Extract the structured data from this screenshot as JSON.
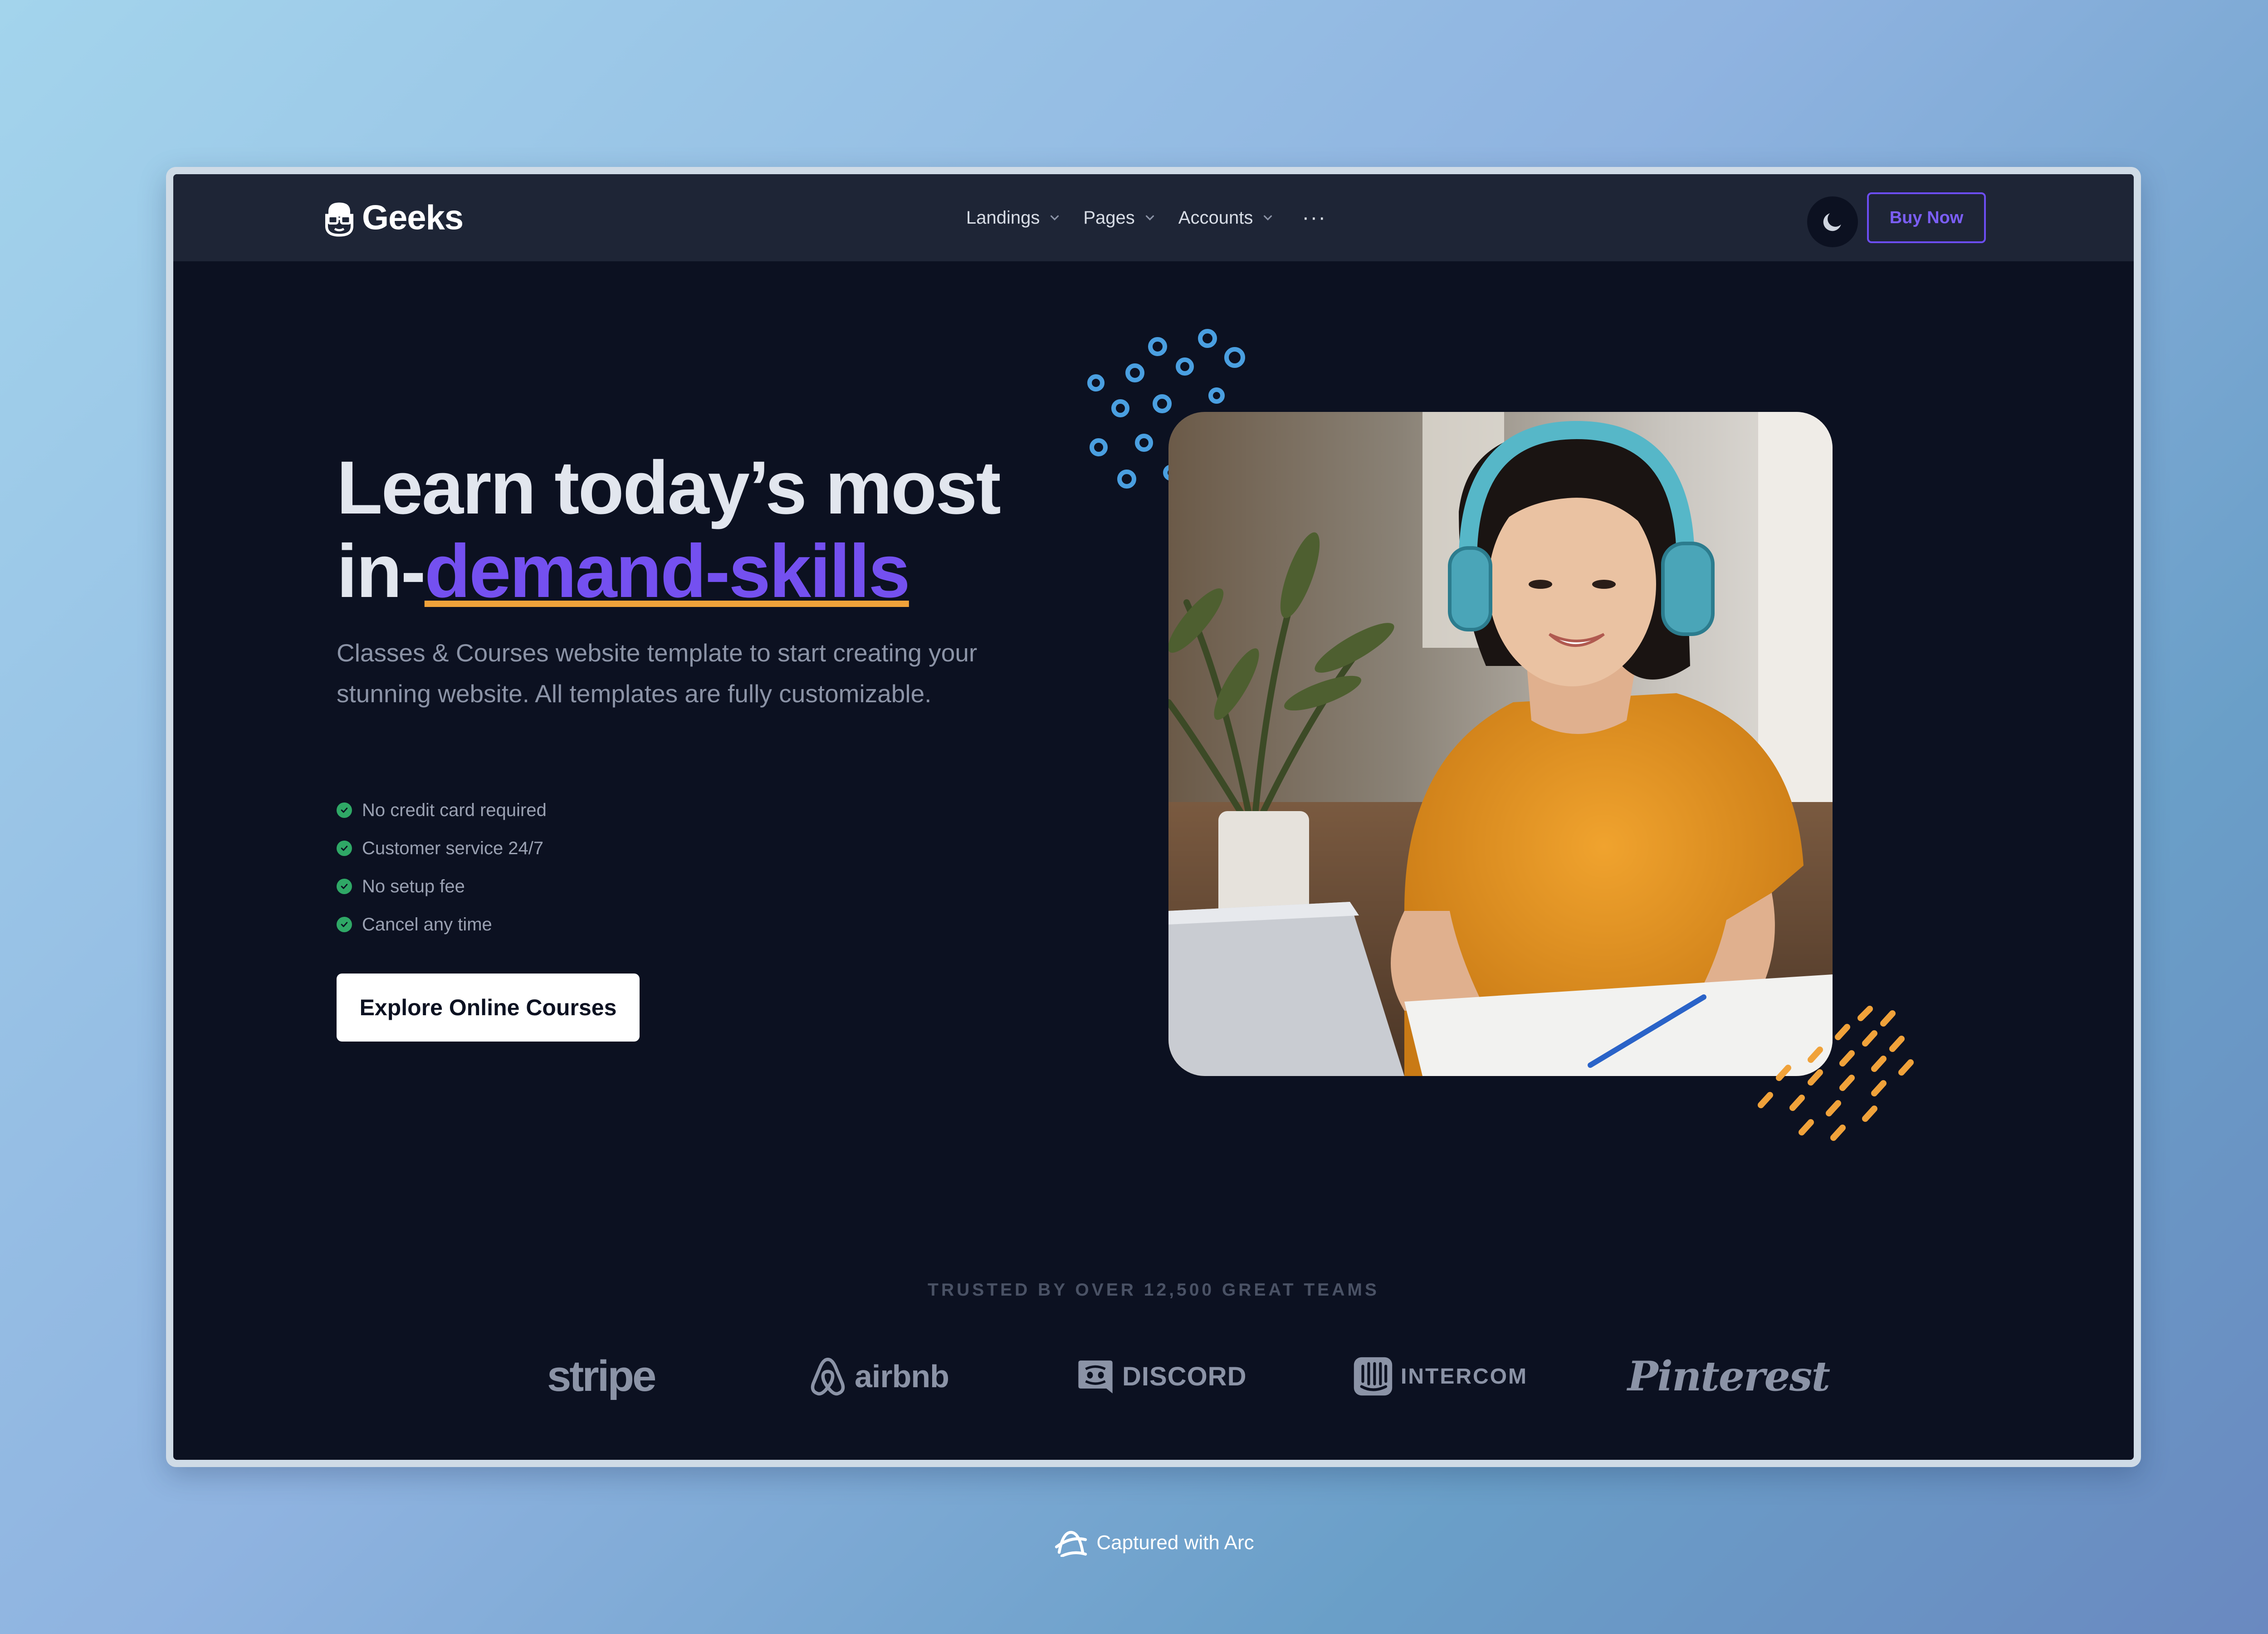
{
  "brand": {
    "name": "Geeks"
  },
  "nav": {
    "items": [
      {
        "label": "Landings"
      },
      {
        "label": "Pages"
      },
      {
        "label": "Accounts"
      }
    ],
    "more_label": "···"
  },
  "header": {
    "buy_label": "Buy Now"
  },
  "hero": {
    "title_line1": "Learn today’s most",
    "title_prefix": "in-",
    "title_accent": "demand-skills",
    "subtitle": "Classes & Courses website template to start creating your stunning website. All templates are fully customizable.",
    "features": [
      "No credit card required",
      "Customer service 24/7",
      "No setup fee",
      "Cancel any time"
    ],
    "cta_label": "Explore Online Courses"
  },
  "trusted": {
    "label": "TRUSTED BY OVER 12,500 GREAT TEAMS",
    "logos": [
      "stripe",
      "airbnb",
      "DISCORD",
      "INTERCOM",
      "Pinterest"
    ]
  },
  "footer": {
    "captured_label": "Captured with Arc"
  },
  "colors": {
    "accent": "#7450f0",
    "underline": "#f0a23a",
    "check": "#2fa866",
    "background": "#0c1121",
    "navbar": "#1e2536"
  },
  "icons": [
    "geek-logo-icon",
    "chevron-down-icon",
    "moon-icon",
    "check-circle-icon",
    "arc-logo-icon"
  ]
}
